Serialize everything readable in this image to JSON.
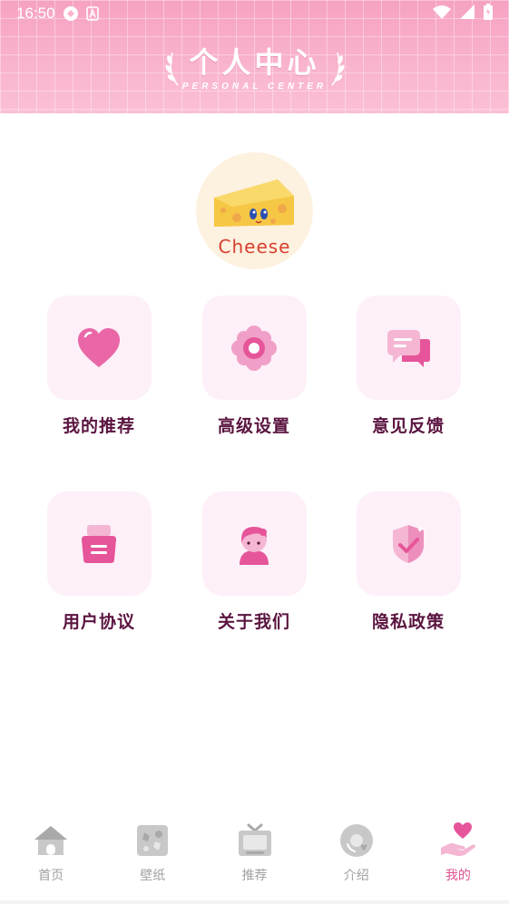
{
  "status_bar": {
    "time": "16:50"
  },
  "header": {
    "title": "个人中心",
    "subtitle": "PERSONAL CENTER"
  },
  "avatar": {
    "text": "Cheese"
  },
  "grid": {
    "items": [
      {
        "label": "我的推荐",
        "icon": "heart-icon"
      },
      {
        "label": "高级设置",
        "icon": "flower-gear-icon"
      },
      {
        "label": "意见反馈",
        "icon": "chat-bubble-icon"
      },
      {
        "label": "用户协议",
        "icon": "document-icon"
      },
      {
        "label": "关于我们",
        "icon": "person-icon"
      },
      {
        "label": "隐私政策",
        "icon": "shield-check-icon"
      }
    ]
  },
  "bottom_nav": {
    "items": [
      {
        "label": "首页",
        "icon": "home-icon"
      },
      {
        "label": "壁纸",
        "icon": "wallpaper-icon"
      },
      {
        "label": "推荐",
        "icon": "tv-icon"
      },
      {
        "label": "介绍",
        "icon": "disc-icon"
      },
      {
        "label": "我的",
        "icon": "hand-heart-icon"
      }
    ],
    "active_index": 4
  },
  "colors": {
    "header_pink": "#f9b3cd",
    "accent_pink": "#e0508f",
    "tile_bg": "#fdf0f8",
    "label_dark": "#5b1540",
    "nav_inactive": "#a0a0a0"
  }
}
